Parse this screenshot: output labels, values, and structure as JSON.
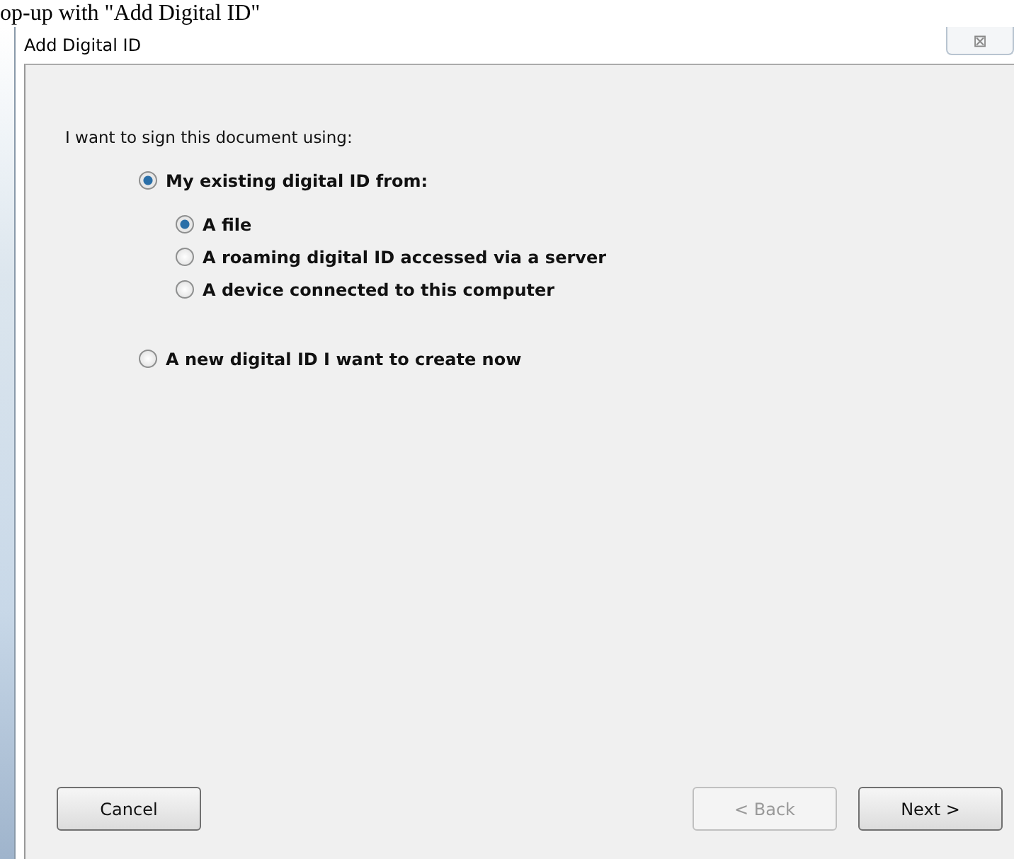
{
  "caption": "op-up with \"Add Digital ID\"",
  "window": {
    "title": "Add Digital ID",
    "close": "⊠"
  },
  "prompt": "I want to sign this document using:",
  "options": [
    {
      "label": "My existing digital ID from:",
      "selected": true,
      "children": [
        {
          "label": "A file",
          "selected": true
        },
        {
          "label": "A roaming digital ID accessed via a server",
          "selected": false
        },
        {
          "label": "A device connected to this computer",
          "selected": false
        }
      ]
    },
    {
      "label": "A new digital ID I want to create now",
      "selected": false
    }
  ],
  "buttons": [
    {
      "label": "Cancel",
      "disabled": false,
      "kind": "left"
    },
    {
      "label": "< Back",
      "disabled": true,
      "kind": "right"
    },
    {
      "label": "Next >",
      "disabled": false,
      "kind": "right"
    }
  ]
}
